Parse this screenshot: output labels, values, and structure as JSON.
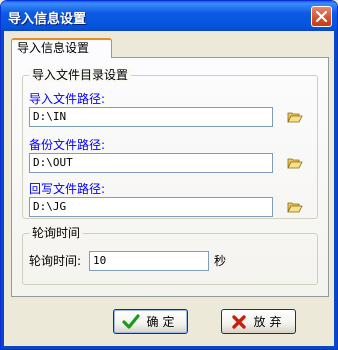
{
  "window": {
    "title": "导入信息设置",
    "close_icon": "close-icon"
  },
  "tab": {
    "label": "导入信息设置"
  },
  "dir_group": {
    "legend": "导入文件目录设置",
    "import_label": "导入文件路径:",
    "import_value": "D:\\IN",
    "backup_label": "备份文件路径:",
    "backup_value": "D:\\OUT",
    "writeback_label": "回写文件路径:",
    "writeback_value": "D:\\JG",
    "browse_icon": "folder-open-icon"
  },
  "poll_group": {
    "legend": "轮询时间",
    "label": "轮询时间:",
    "value": "10",
    "unit": "秒"
  },
  "buttons": {
    "ok_label": "确定",
    "cancel_label": "放弃",
    "ok_icon": "checkmark-icon",
    "cancel_icon": "x-icon"
  },
  "colors": {
    "titlebar": "#0553dc",
    "field_label": "#0000ff",
    "tab_highlight": "#e68b2c"
  }
}
